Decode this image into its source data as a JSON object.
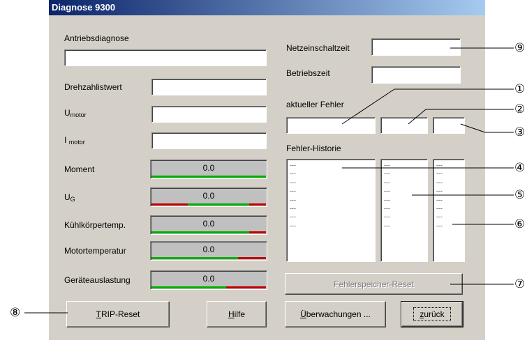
{
  "window": {
    "title": "Diagnose 9300"
  },
  "left": {
    "section_label": "Antriebsdiagnose",
    "drehzahl_label": "Drehzahlistwert",
    "umotor_main": "U",
    "umotor_sub": "motor",
    "imotor_main": "I",
    "imotor_sub": "motor",
    "moment_label": "Moment",
    "ug_main": "U",
    "ug_sub": "G",
    "kuehl_label": "Kühlkörpertemp.",
    "motortemp_label": "Motortemperatur",
    "auslastung_label": "Geräteauslastung",
    "meters": [
      {
        "name": "Moment",
        "value": "0.0",
        "level": 1.0,
        "green": 1.0
      },
      {
        "name": "UG",
        "value": "0.0",
        "level": 1.0,
        "red_start": 0.32,
        "green_end": 0.85
      },
      {
        "name": "Kühlkörpertemp.",
        "value": "0.0",
        "level": 1.0,
        "green_end": 0.85
      },
      {
        "name": "Motortemperatur",
        "value": "0.0",
        "level": 1.0,
        "green_end": 0.75
      },
      {
        "name": "Geräteauslastung",
        "value": "0.0",
        "level": 1.0,
        "green_end": 0.65
      }
    ]
  },
  "right": {
    "netz_label": "Netzeinschaltzeit",
    "betrieb_label": "Betriebszeit",
    "fehler_label": "aktueller Fehler",
    "historie_label": "Fehler-Historie",
    "history_col1": [
      "---",
      "---",
      "---",
      "---",
      "---",
      "---",
      "---",
      "---"
    ],
    "history_col2": [
      "---",
      "---",
      "---",
      "---",
      "---",
      "---",
      "---",
      "---"
    ],
    "history_col3": [
      "---",
      "---",
      "---",
      "---",
      "---",
      "---",
      "---",
      "---"
    ]
  },
  "buttons": {
    "fehlerspeicher_reset": "Fehlerspeicher-Reset",
    "trip_reset_u": "T",
    "trip_reset_rest": "RIP-Reset",
    "hilfe_u": "H",
    "hilfe_rest": "ilfe",
    "ueberwachungen_u": "Ü",
    "ueberwachungen_rest": "berwachungen ...",
    "zurueck_u": "z",
    "zurueck_rest": "urück"
  },
  "callouts": [
    "①",
    "②",
    "③",
    "④",
    "⑤",
    "⑥",
    "⑦",
    "⑧",
    "⑨"
  ],
  "colors": {
    "title_start": "#0a246a",
    "title_end": "#a6caf0",
    "green": "#00b000",
    "red": "#c00000"
  }
}
